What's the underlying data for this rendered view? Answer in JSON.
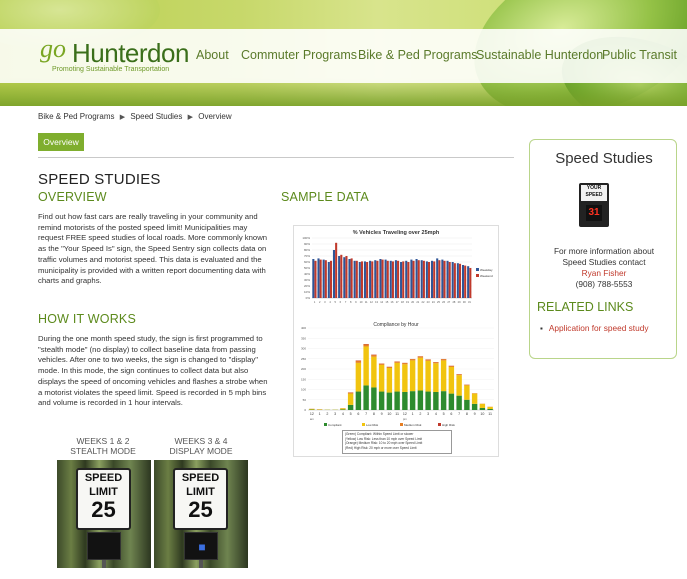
{
  "logo": {
    "go": "go",
    "name": "Hunterdon",
    "tagline": "Promoting Sustainable Transportation"
  },
  "nav": {
    "items": [
      "About",
      "Commuter Programs",
      "Bike & Ped Programs",
      "Sustainable Hunterdon",
      "Public Transit"
    ]
  },
  "breadcrumb": [
    "Bike & Ped Programs",
    "Speed Studies",
    "Overview"
  ],
  "tabs": {
    "overview": "Overview"
  },
  "main": {
    "title": "SPEED STUDIES",
    "overview_heading": "OVERVIEW",
    "overview_text": "Find out how fast cars are really traveling in your community and remind motorists of the posted speed limit! Municipalities may request FREE speed studies of local roads. More commonly known as the \"Your Speed Is\" sign, the Speed Sentry sign collects data on traffic volumes and motorist speed. This data is evaluated and the municipality is provided with a written report documenting data with charts and graphs.",
    "how_heading": "HOW IT WORKS",
    "how_text": "During the one month speed study, the sign is first programmed to \"stealth mode\" (no display) to collect baseline data from passing vehicles. After one to two weeks, the sign is changed to \"display\" mode. In this mode, the sign continues to collect data but also displays the speed of oncoming vehicles and flashes a strobe when a motorist violates the speed limit. Speed is recorded in 5 mph bins and volume is recorded in 1 hour intervals.",
    "sample_heading": "SAMPLE DATA"
  },
  "photos": {
    "left_label_1": "WEEKS 1 & 2",
    "left_label_2": "STEALTH MODE",
    "right_label_1": "WEEKS 3 & 4",
    "right_label_2": "DISPLAY MODE",
    "sign_line1": "SPEED",
    "sign_line2": "LIMIT",
    "sign_number": "25"
  },
  "chart_data": [
    {
      "type": "bar",
      "title": "% Vehicles Traveling over 25mph",
      "xlabel": "",
      "ylabel": "",
      "ylim": [
        0,
        100
      ],
      "yticks": [
        "0%",
        "10%",
        "20%",
        "30%",
        "40%",
        "50%",
        "60%",
        "70%",
        "80%",
        "90%",
        "100%"
      ],
      "categories": [
        "1",
        "2",
        "3",
        "4",
        "5",
        "6",
        "7",
        "8",
        "9",
        "10",
        "11",
        "12",
        "13",
        "14",
        "15",
        "16",
        "17",
        "18",
        "19",
        "20",
        "21",
        "22",
        "23",
        "24",
        "25",
        "26",
        "27",
        "28",
        "29",
        "30",
        "31"
      ],
      "series": [
        {
          "name": "Weekday",
          "color": "#2f5597",
          "values": [
            65,
            66,
            64,
            60,
            80,
            70,
            68,
            65,
            62,
            60,
            61,
            62,
            63,
            65,
            64,
            62,
            63,
            60,
            62,
            64,
            65,
            63,
            61,
            62,
            66,
            64,
            62,
            60,
            58,
            55,
            53
          ]
        },
        {
          "name": "Weekend",
          "color": "#c0392b",
          "values": [
            62,
            64,
            63,
            62,
            92,
            72,
            70,
            66,
            62,
            61,
            60,
            61,
            62,
            64,
            62,
            61,
            62,
            61,
            60,
            62,
            63,
            62,
            60,
            61,
            63,
            62,
            60,
            58,
            57,
            54,
            50
          ]
        }
      ]
    },
    {
      "type": "bar",
      "title": "Compliance by Hour",
      "xlabel": "",
      "ylabel": "",
      "ylim": [
        0,
        400
      ],
      "yticks": [
        "0",
        "50",
        "100",
        "150",
        "200",
        "250",
        "300",
        "350",
        "400"
      ],
      "categories": [
        "12",
        "1",
        "2",
        "3",
        "4",
        "5",
        "6",
        "7",
        "8",
        "9",
        "10",
        "11",
        "12",
        "1",
        "2",
        "3",
        "4",
        "5",
        "6",
        "7",
        "8",
        "9",
        "10",
        "11"
      ],
      "category_notes": {
        "am": "am",
        "pm": "pm"
      },
      "series": [
        {
          "name": "Compliant",
          "color": "#2e8b2e",
          "values": [
            2,
            1,
            1,
            1,
            3,
            25,
            90,
            120,
            110,
            90,
            85,
            90,
            88,
            92,
            95,
            90,
            88,
            92,
            80,
            70,
            50,
            30,
            10,
            5
          ]
        },
        {
          "name": "Low Risk",
          "color": "#f1c40f",
          "values": [
            3,
            2,
            1,
            1,
            5,
            55,
            140,
            190,
            150,
            130,
            120,
            140,
            135,
            150,
            160,
            150,
            140,
            150,
            130,
            100,
            70,
            50,
            20,
            10
          ]
        },
        {
          "name": "Medium Risk",
          "color": "#e67e22",
          "values": [
            1,
            1,
            0,
            0,
            1,
            5,
            10,
            10,
            8,
            6,
            5,
            6,
            6,
            6,
            6,
            6,
            5,
            6,
            5,
            4,
            3,
            2,
            1,
            1
          ]
        },
        {
          "name": "High Risk",
          "color": "#c0392b",
          "values": [
            0,
            0,
            0,
            0,
            0,
            1,
            2,
            2,
            2,
            1,
            1,
            1,
            1,
            1,
            1,
            1,
            1,
            1,
            1,
            1,
            1,
            0,
            0,
            0
          ]
        }
      ]
    }
  ],
  "sample_legend": [
    "(Green) Compliant: Within Speed Limit or slower",
    "(Yellow) Low Risk: Less than 10 mph over Speed Limit",
    "(Orange) Medium Risk: 10 to 20 mph over Speed Limit",
    "(Red) High Risk: 20 mph or more over Speed Limit"
  ],
  "sidebar": {
    "title": "Speed Studies",
    "sign_top": "YOUR SPEED",
    "sign_number": "31",
    "info_line1": "For more information about",
    "info_line2": "Speed Studies contact",
    "contact_name": "Ryan Fisher",
    "phone": "(908) 788-5553",
    "related_heading": "RELATED LINKS",
    "links": [
      "Application for speed study"
    ]
  },
  "colors": {
    "brand_green": "#5c8a1c",
    "tab_green": "#7fae2e",
    "link_red": "#c0392b",
    "nav_text": "#5a7a2a"
  }
}
